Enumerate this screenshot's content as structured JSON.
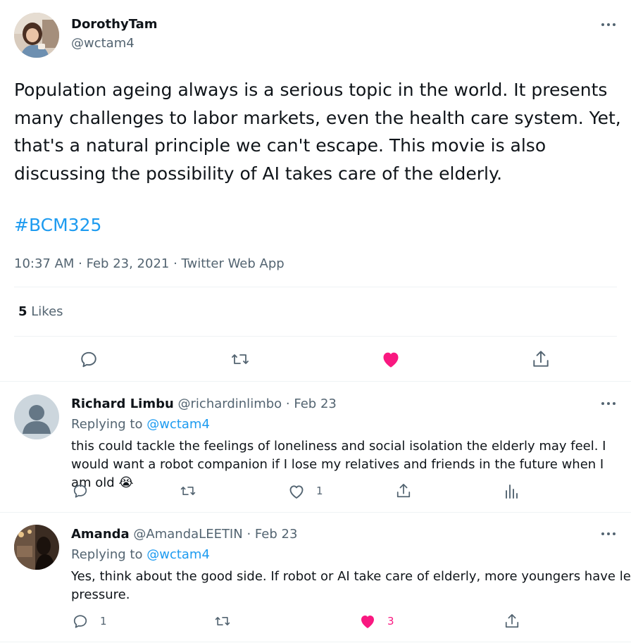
{
  "main_tweet": {
    "display_name": "DorothyTam",
    "handle": "@wctam4",
    "body": "Population ageing always is a serious topic in the world. It presents many challenges to labor markets, even the health care system. Yet, that's a natural principle we can't escape. This movie is also discussing the possibility of AI takes care of the elderly.",
    "hashtag": "#BCM325",
    "meta": "10:37 AM · Feb 23, 2021 · Twitter Web App",
    "likes_count": "5",
    "likes_label": "Likes",
    "liked": true,
    "colors": {
      "like": "#f91880",
      "link": "#1d9bf0",
      "muted": "#536471"
    }
  },
  "replies": [
    {
      "display_name": "Richard Limbu",
      "handle": "@richardinlimbo",
      "date": "· Feb 23",
      "replying_label": "Replying to",
      "replying_handle": "@wctam4",
      "body": "this could tackle the feelings of loneliness and social isolation the elderly may feel. I would want a robot companion if I lose my relatives and friends in the future when I am old",
      "emoji": "😭",
      "like_count": "1",
      "liked": false
    },
    {
      "display_name": "Amanda",
      "handle": "@AmandaLEETIN",
      "date": "· Feb 23",
      "replying_label": "Replying to",
      "replying_handle": "@wctam4",
      "body_line1": "Yes, think about the good side. If robot or AI take care of elderly, more youngers have less",
      "body_line2": "pressure.",
      "reply_count": "1",
      "like_count": "3",
      "liked": true
    }
  ]
}
